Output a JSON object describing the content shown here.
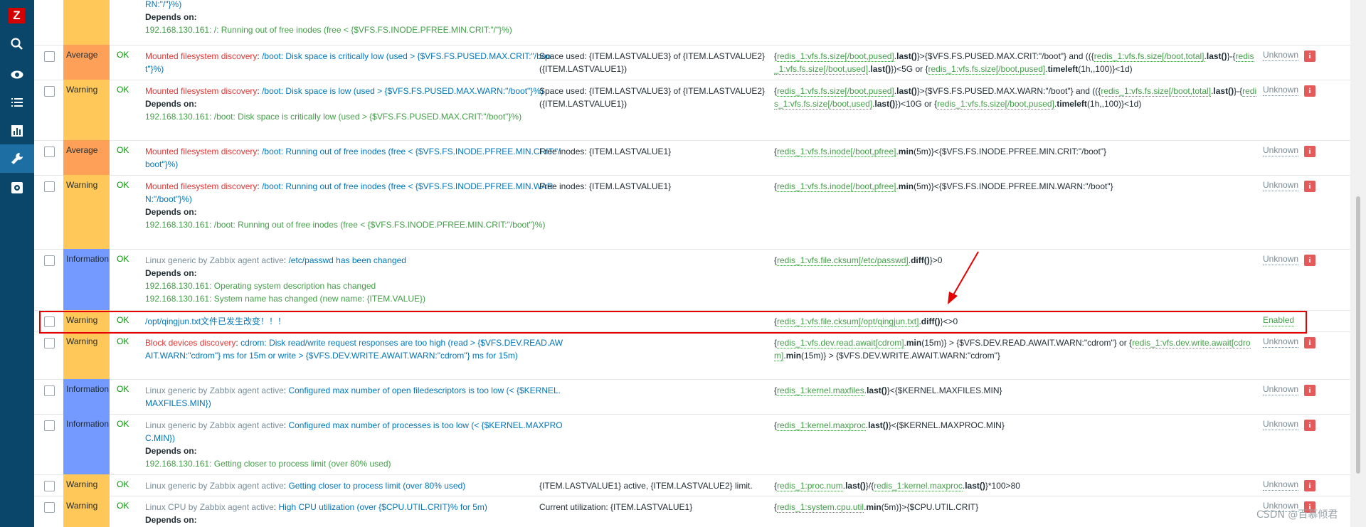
{
  "sidebar": {
    "logo": "Z",
    "icons": [
      "search-icon",
      "eye-icon",
      "list-icon",
      "chart-icon",
      "wrench-icon",
      "gear-icon"
    ]
  },
  "rows": [
    {
      "severity": "",
      "status": "",
      "name_parts": [
        "RN:\"/\"}%)"
      ],
      "depends_label": "Depends on:",
      "depends": [
        "192.168.130.161: /: Running out of free inodes (free < {$VFS.FS.INODE.PFREE.MIN.CRIT:\"/\"}%)"
      ],
      "opdata": "",
      "expr": ""
    },
    {
      "severity": "Average",
      "status": "OK",
      "template": "Mounted filesystem discovery",
      "name": "/boot: Disk space is critically low (used > {$VFS.FS.PUSED.MAX.CRIT:\"/boot\"}%)",
      "opdata": "Space used: {ITEM.LASTVALUE3} of {ITEM.LASTVALUE2} ({ITEM.LASTVALUE1})",
      "expr_html": "{<span class=\"g\">redis_1:vfs.fs.size[/boot,pused]</span>.<b>last()</b>}>{$VFS.FS.PUSED.MAX.CRIT:\"/boot\"} and (({<span class=\"g\">redis_1:vfs.fs.size[/boot,total]</span>.<b>last()</b>}-{<span class=\"g\">redis_1:vfs.fs.size[/boot,used]</span>.<b>last()</b>})<5G or {<span class=\"g\">redis_1:vfs.fs.size[/boot,pused]</span>.<b>timeleft</b>(1h,,100)}<1d)",
      "trigger_status": "Unknown"
    },
    {
      "severity": "Warning",
      "status": "OK",
      "template": "Mounted filesystem discovery",
      "name": "/boot: Disk space is low (used > {$VFS.FS.PUSED.MAX.WARN:\"/boot\"}%)",
      "depends_label": "Depends on:",
      "depends": [
        "192.168.130.161: /boot: Disk space is critically low (used > {$VFS.FS.PUSED.MAX.CRIT:\"/boot\"}%)"
      ],
      "opdata": "Space used: {ITEM.LASTVALUE3} of {ITEM.LASTVALUE2} ({ITEM.LASTVALUE1})",
      "expr_html": "{<span class=\"g\">redis_1:vfs.fs.size[/boot,pused]</span>.<b>last()</b>}>{$VFS.FS.PUSED.MAX.WARN:\"/boot\"} and (({<span class=\"g\">redis_1:vfs.fs.size[/boot,total]</span>.<b>last()</b>}-{<span class=\"g\">redis_1:vfs.fs.size[/boot,used]</span>.<b>last()</b>})<10G or {<span class=\"g\">redis_1:vfs.fs.size[/boot,pused]</span>.<b>timeleft</b>(1h,,100)}<1d)",
      "trigger_status": "Unknown"
    },
    {
      "severity": "Average",
      "status": "OK",
      "template": "Mounted filesystem discovery",
      "name": "/boot: Running out of free inodes (free < {$VFS.FS.INODE.PFREE.MIN.CRIT:\"/boot\"}%)",
      "opdata": "Free inodes: {ITEM.LASTVALUE1}",
      "expr_html": "{<span class=\"g\">redis_1:vfs.fs.inode[/boot,pfree]</span>.<b>min</b>(5m)}<{$VFS.FS.INODE.PFREE.MIN.CRIT:\"/boot\"}",
      "trigger_status": "Unknown"
    },
    {
      "severity": "Warning",
      "status": "OK",
      "template": "Mounted filesystem discovery",
      "name": "/boot: Running out of free inodes (free < {$VFS.FS.INODE.PFREE.MIN.WARN:\"/boot\"}%)",
      "depends_label": "Depends on:",
      "depends": [
        "192.168.130.161: /boot: Running out of free inodes (free < {$VFS.FS.INODE.PFREE.MIN.CRIT:\"/boot\"}%)"
      ],
      "opdata": "Free inodes: {ITEM.LASTVALUE1}",
      "expr_html": "{<span class=\"g\">redis_1:vfs.fs.inode[/boot,pfree]</span>.<b>min</b>(5m)}<{$VFS.FS.INODE.PFREE.MIN.WARN:\"/boot\"}",
      "trigger_status": "Unknown"
    },
    {
      "severity": "Information",
      "status": "OK",
      "template": "Linux generic by Zabbix agent active",
      "name": "/etc/passwd has been changed",
      "depends_label": "Depends on:",
      "depends": [
        "192.168.130.161: Operating system description has changed",
        "192.168.130.161: System name has changed (new name: {ITEM.VALUE})"
      ],
      "opdata": "",
      "expr_html": "{<span class=\"g\">redis_1:vfs.file.cksum[/etc/passwd]</span>.<b>diff()</b>}>0",
      "trigger_status": "Unknown"
    },
    {
      "severity": "Warning",
      "status": "OK",
      "template": "",
      "name": "/opt/qingjun.txt文件已发生改变！！！",
      "opdata": "",
      "expr_html": "{<span class=\"g\">redis_1:vfs.file.cksum[/opt/qingjun.txt]</span>.<b>diff()</b>}<>0",
      "trigger_status": "Enabled"
    },
    {
      "severity": "Warning",
      "status": "OK",
      "template": "Block devices discovery",
      "name": "cdrom: Disk read/write request responses are too high (read > {$VFS.DEV.READ.AWAIT.WARN:\"cdrom\"} ms for 15m or write > {$VFS.DEV.WRITE.AWAIT.WARN:\"cdrom\"} ms for 15m)",
      "opdata": "",
      "expr_html": "{<span class=\"g\">redis_1:vfs.dev.read.await[cdrom]</span>.<b>min</b>(15m)} > {$VFS.DEV.READ.AWAIT.WARN:\"cdrom\"} or {<span class=\"g\">redis_1:vfs.dev.write.await[cdrom]</span>.<b>min</b>(15m)} > {$VFS.DEV.WRITE.AWAIT.WARN:\"cdrom\"}",
      "trigger_status": "Unknown"
    },
    {
      "severity": "Information",
      "status": "OK",
      "template": "Linux generic by Zabbix agent active",
      "name": "Configured max number of open filedescriptors is too low (< {$KERNEL.MAXFILES.MIN})",
      "opdata": "",
      "expr_html": "{<span class=\"g\">redis_1:kernel.maxfiles</span>.<b>last()</b>}<{$KERNEL.MAXFILES.MIN}",
      "trigger_status": "Unknown"
    },
    {
      "severity": "Information",
      "status": "OK",
      "template": "Linux generic by Zabbix agent active",
      "name": "Configured max number of processes is too low (< {$KERNEL.MAXPROC.MIN})",
      "depends_label": "Depends on:",
      "depends": [
        "192.168.130.161: Getting closer to process limit (over 80% used)"
      ],
      "opdata": "",
      "expr_html": "{<span class=\"g\">redis_1:kernel.maxproc</span>.<b>last()</b>}<{$KERNEL.MAXPROC.MIN}",
      "trigger_status": "Unknown"
    },
    {
      "severity": "Warning",
      "status": "OK",
      "template": "Linux generic by Zabbix agent active",
      "name": "Getting closer to process limit (over 80% used)",
      "opdata": "{ITEM.LASTVALUE1} active, {ITEM.LASTVALUE2} limit.",
      "expr_html": "{<span class=\"g\">redis_1:proc.num</span>.<b>last()</b>}/{<span class=\"g\">redis_1:kernel.maxproc</span>.<b>last()</b>}*100>80",
      "trigger_status": "Unknown"
    },
    {
      "severity": "Warning",
      "status": "OK",
      "template": "Linux CPU by Zabbix agent active",
      "name": "High CPU utilization (over {$CPU.UTIL.CRIT}% for 5m)",
      "depends_label": "Depends on:",
      "depends": [],
      "opdata": "Current utilization: {ITEM.LASTVALUE1}",
      "expr_html": "{<span class=\"g\">redis_1:system.cpu.util</span>.<b>min</b>(5m)}>{$CPU.UTIL.CRIT}",
      "trigger_status": "Unknown"
    }
  ],
  "watermark": "CSDN @百慕倾君"
}
